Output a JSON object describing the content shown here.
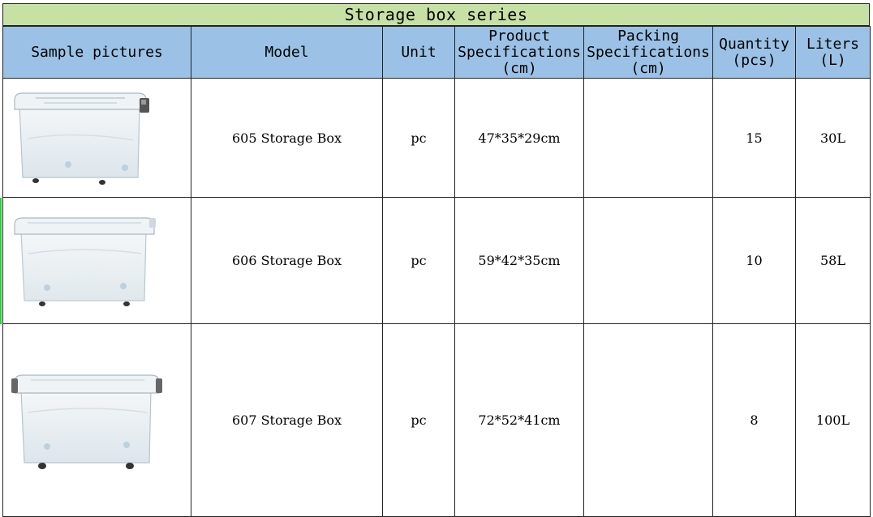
{
  "title": "Storage box series",
  "headers": {
    "sample": "Sample pictures",
    "model": "Model",
    "unit": "Unit",
    "product_spec": [
      "Product",
      "Specifications",
      "(cm)"
    ],
    "packing_spec": [
      "Packing",
      "Specifications",
      "(cm)"
    ],
    "quantity": [
      "Quantity",
      "(pcs)"
    ],
    "liters": [
      "Liters",
      "(L)"
    ]
  },
  "rows": [
    {
      "model": "605 Storage Box",
      "unit": "pc",
      "product_spec": "47*35*29cm",
      "packing_spec": "",
      "quantity": "15",
      "liters": "30L",
      "image": "storage-box-605-image"
    },
    {
      "model": "606 Storage Box",
      "unit": "pc",
      "product_spec": "59*42*35cm",
      "packing_spec": "",
      "quantity": "10",
      "liters": "58L",
      "image": "storage-box-606-image"
    },
    {
      "model": "607 Storage Box",
      "unit": "pc",
      "product_spec": "72*52*41cm",
      "packing_spec": "",
      "quantity": "8",
      "liters": "100L",
      "image": "storage-box-607-image"
    }
  ],
  "colors": {
    "title_bg": "#c7e1a4",
    "header_bg": "#9bc2e6",
    "border": "#222222"
  }
}
